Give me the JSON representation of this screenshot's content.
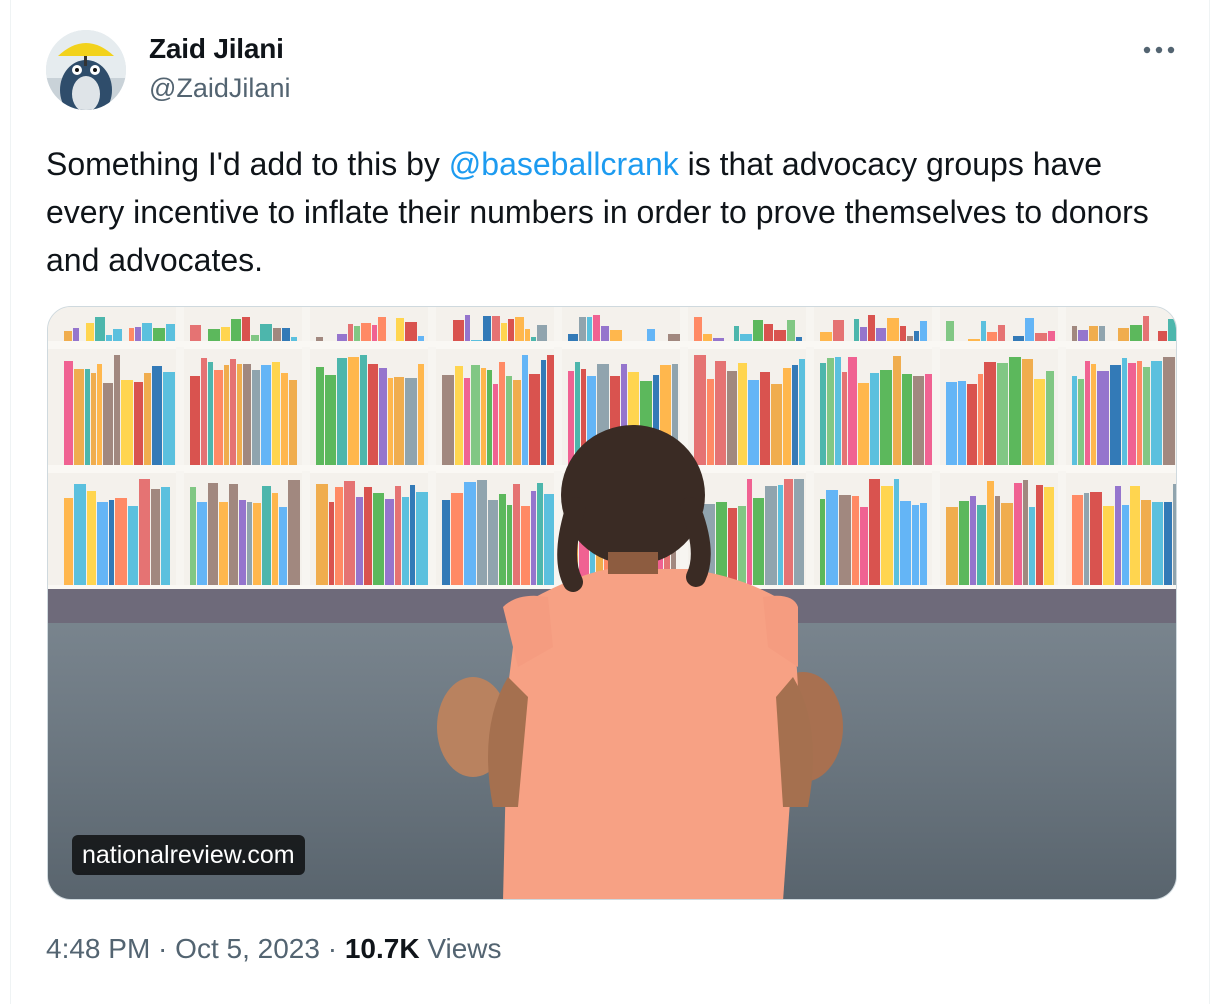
{
  "author": {
    "name": "Zaid Jilani",
    "handle": "@ZaidJilani"
  },
  "icons": {
    "more": "more-horizontal-icon",
    "avatar": "avatar-image"
  },
  "tweet": {
    "text_before": "Something I'd add to this by ",
    "mention": "@baseballcrank",
    "text_after": " is that advocacy groups have every incentive to inflate their numbers in order to prove themselves to donors and advocates."
  },
  "media": {
    "link_domain": "nationalreview.com"
  },
  "meta": {
    "time": "4:48 PM",
    "separator": " · ",
    "date": "Oct 5, 2023",
    "views_count": "10.7K",
    "views_label": " Views"
  },
  "colors": {
    "link": "#1d9bf0",
    "secondary_text": "#536471",
    "primary_text": "#0f1419"
  }
}
